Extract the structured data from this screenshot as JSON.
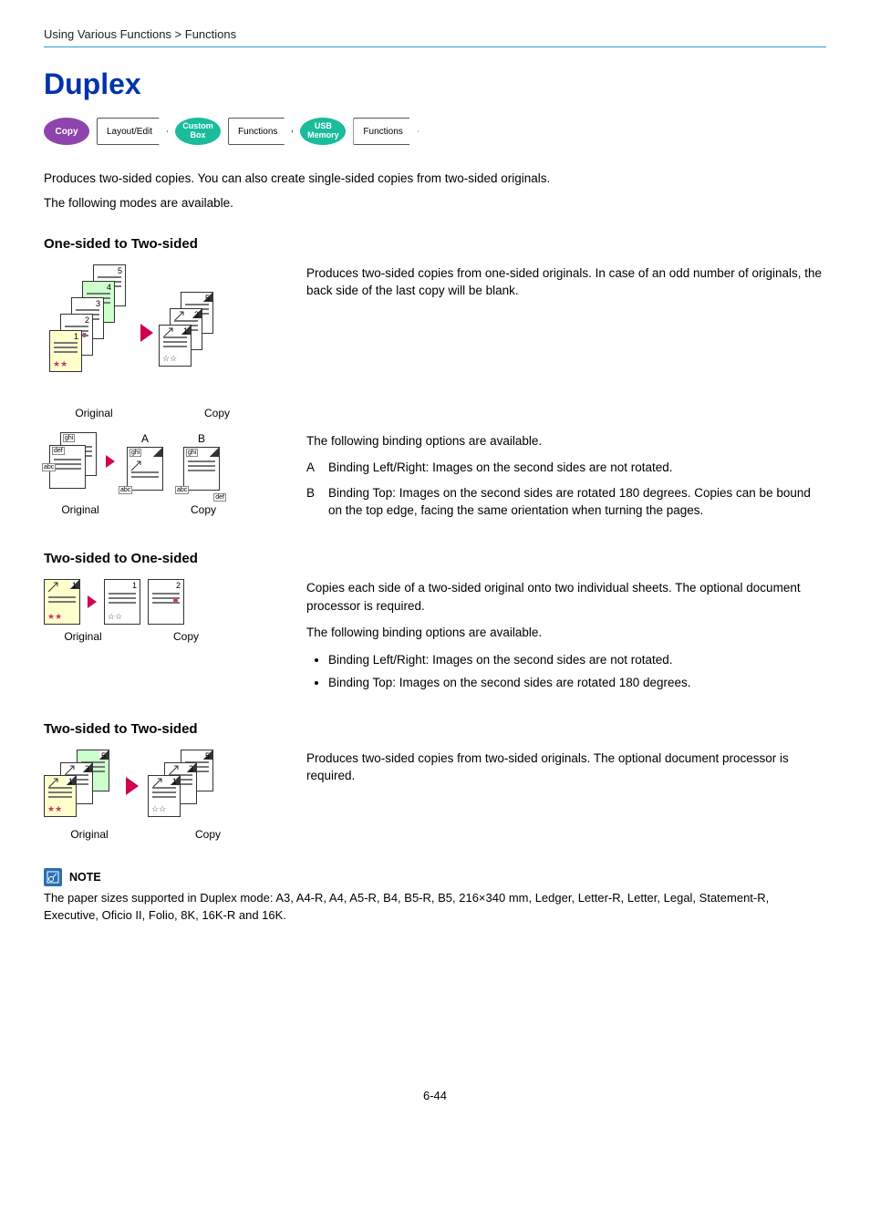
{
  "breadcrumb": "Using Various Functions > Functions",
  "title": "Duplex",
  "badges": {
    "copy": "Copy",
    "layout": "Layout/Edit",
    "custom_box": "Custom Box",
    "functions1": "Functions",
    "usb": "USB Memory",
    "functions2": "Functions"
  },
  "intro1": "Produces two-sided copies. You can also create single-sided copies from two-sided originals.",
  "intro2": "The following modes are available.",
  "s1": {
    "heading": "One-sided to Two-sided",
    "original_label": "Original",
    "copy_label": "Copy",
    "desc": "Produces two-sided copies from one-sided originals. In case of an odd number of originals, the back side of the last copy will be blank.",
    "ab_a": "A",
    "ab_b": "B",
    "binding_intro": "The following binding options are available.",
    "binding_a": "Binding Left/Right: Images on the second sides are not rotated.",
    "binding_b": "Binding Top: Images on the second sides are rotated 180 degrees. Copies can be bound on the top edge, facing the same orientation when turning the pages."
  },
  "s2": {
    "heading": "Two-sided to One-sided",
    "original_label": "Original",
    "copy_label": "Copy",
    "desc": "Copies each side of a two-sided original onto two individual sheets. The optional document processor is required.",
    "binding_intro": "The following binding options are available.",
    "bullet1": "Binding Left/Right: Images on the second sides are not rotated.",
    "bullet2": "Binding Top: Images on the second sides are rotated 180 degrees."
  },
  "s3": {
    "heading": "Two-sided to Two-sided",
    "original_label": "Original",
    "copy_label": "Copy",
    "desc": "Produces two-sided copies from two-sided originals. The optional document processor is required."
  },
  "note": {
    "label": "NOTE",
    "text": "The paper sizes supported in Duplex mode: A3, A4-R, A4, A5-R, B4, B5-R, B5, 216×340 mm, Ledger, Letter-R, Letter, Legal, Statement-R, Executive, Oficio II, Folio, 8K, 16K-R and 16K."
  },
  "diagram_tokens": {
    "p1": "1",
    "p2": "2",
    "p3": "3",
    "p4": "4",
    "p5": "5",
    "abc": "abc",
    "def": "def",
    "ghi": "ghi"
  },
  "page_number": "6-44"
}
